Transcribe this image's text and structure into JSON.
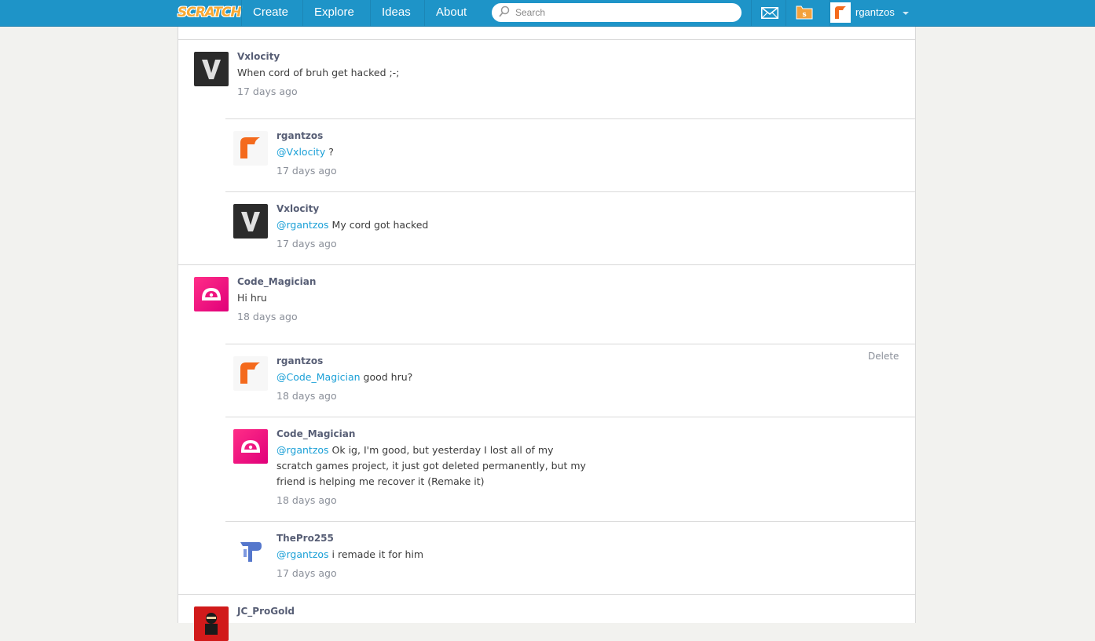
{
  "nav": {
    "logo": "SCRATCH",
    "links": [
      "Create",
      "Explore",
      "Ideas",
      "About"
    ],
    "search_placeholder": "Search",
    "username": "rgantzos",
    "colors": {
      "bar": "#1e94c8",
      "accent": "#f7a833"
    }
  },
  "comments": [
    {
      "author": "Vxlocity",
      "mention": "",
      "text": "When cord of bruh get hacked ;-;",
      "time": "17 days ago"
    },
    {
      "author": "rgantzos",
      "mention": "@Vxlocity",
      "text": " ?",
      "time": "17 days ago"
    },
    {
      "author": "Vxlocity",
      "mention": "@rgantzos",
      "text": " My cord got hacked",
      "time": "17 days ago"
    },
    {
      "author": "Code_Magician",
      "mention": "",
      "text": "Hi hru",
      "time": "18 days ago"
    },
    {
      "author": "rgantzos",
      "mention": "@Code_Magician",
      "text": " good hru?",
      "time": "18 days ago",
      "delete_label": "Delete"
    },
    {
      "author": "Code_Magician",
      "mention": "@rgantzos",
      "text": " Ok ig, I'm good, but yesterday I lost all of my scratch games project, it just got deleted permanently, but my friend is helping me recover it (Remake it)",
      "time": "18 days ago"
    },
    {
      "author": "ThePro255",
      "mention": "@rgantzos",
      "text": " i remade it for him",
      "time": "17 days ago"
    },
    {
      "author": "JC_ProGold",
      "mention": "",
      "text": "",
      "time": ""
    }
  ]
}
